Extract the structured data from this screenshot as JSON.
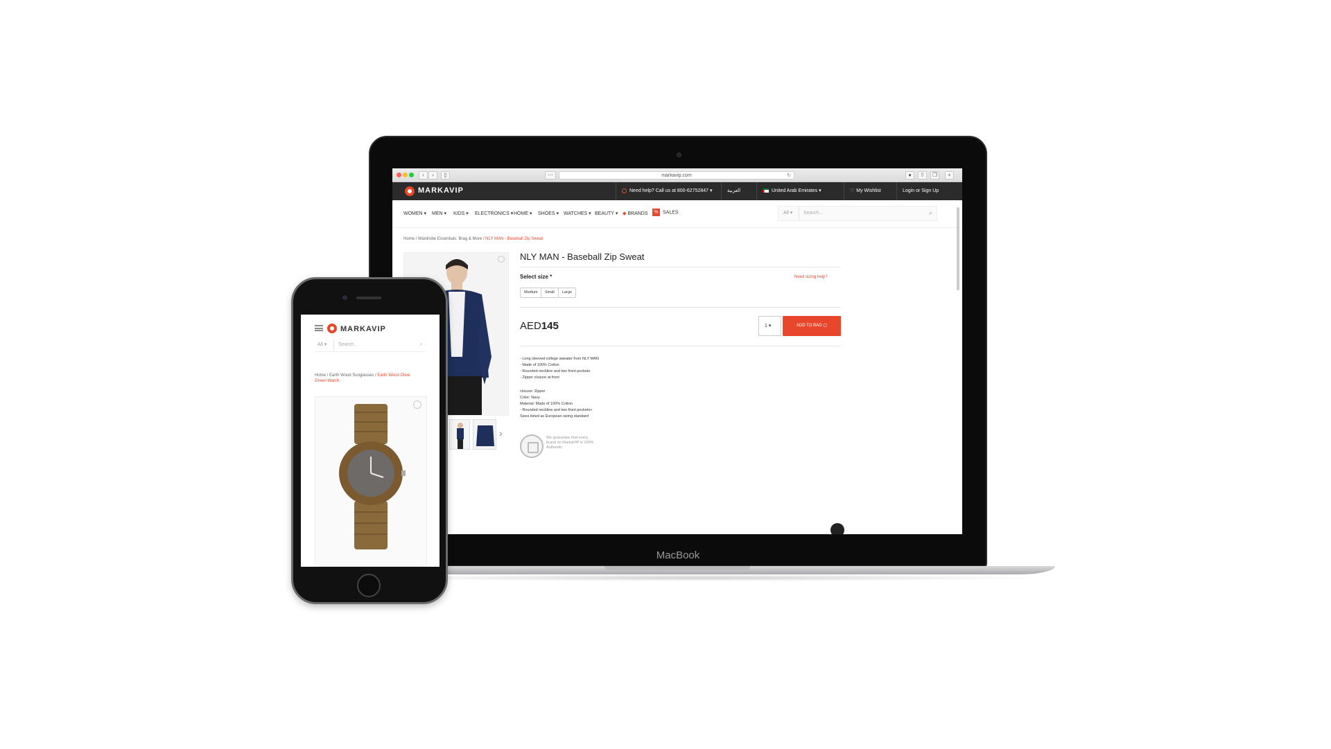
{
  "laptop": {
    "brand_label": "MacBook",
    "browser": {
      "url": "markavip.com",
      "reload_icon": "reload-icon"
    },
    "header": {
      "logo": "MARKAVIP",
      "help": "Need help? Call us at 800-62752847",
      "language": "العربية",
      "country": "United Arab Emirates",
      "wishlist": "My Wishlist",
      "login": "Login or Sign Up"
    },
    "nav": {
      "items": [
        "WOMEN ▾",
        "MEN ▾",
        "KIDS ▾",
        "ELECTRONICS ▾",
        "HOME ▾",
        "SHOES ▾",
        "WATCHES ▾",
        "BEAUTY ▾",
        "BRANDS",
        "SALES"
      ],
      "search_category": "All",
      "search_placeholder": "Search..."
    },
    "breadcrumb": {
      "home": "Home /",
      "category": "Wardrobe Essentials: Brag & More /",
      "current": "NLY MAN - Baseball Zip Sweat"
    },
    "product": {
      "title": "NLY MAN - Baseball Zip Sweat",
      "select_size": "Select size *",
      "size_help": "Need sizing help?",
      "sizes": [
        "Medium",
        "Small",
        "Large"
      ],
      "currency": "AED",
      "price": "145",
      "quantity": "1 ▾",
      "add_to_bag": "ADD TO BAG",
      "description_1": "- Long sleeved college sweater from NLY MAN\n- Made of 100% Cotton\n- Rounded neckline and two front pockets\n- Zipper closure at front",
      "description_2": "closure: Zipper\nColor: Navy\nMaterial: Made of 100% Cotton\n- Rounded neckline and two front pockets+\nSizes listed as European sizing standard",
      "authenticity": "We guarantee that every brand on MarkaVIP is 100% Authentic."
    }
  },
  "phone": {
    "logo": "MARKAVIP",
    "search_category": "All ▾",
    "search_placeholder": "Search...",
    "breadcrumb": {
      "home": "Home /",
      "category": "Earth Wood Sunglasses /",
      "current": "Earth Wood Olive Green Watch"
    }
  },
  "colors": {
    "accent": "#e8472b",
    "header_bg": "#2b2b2b",
    "device_frame": "#0b0b0b"
  }
}
